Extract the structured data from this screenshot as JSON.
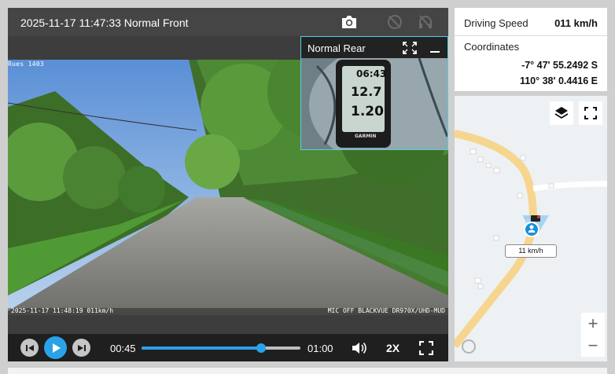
{
  "player": {
    "title": "2025-11-17 11:47:33 Normal Front",
    "osd_top": "Rues 1403",
    "osd_bottom_left": "2025-11-17 11:48:19 011km/h",
    "osd_bottom_right": "MIC OFF BLACKVUE DR970X/UHD-MUD",
    "pip_title": "Normal Rear",
    "pip_readout": {
      "time": "06:43",
      "speed": "12.7",
      "distance": "1.20",
      "brand": "GARMIN"
    },
    "current_time": "00:45",
    "duration": "01:00",
    "progress": 0.75,
    "playback_rate": "2X"
  },
  "info": {
    "speed_label": "Driving Speed",
    "speed_value": "011 km/h",
    "coords_label": "Coordinates",
    "latitude": "-7° 47' 55.2492 S",
    "longitude": "110° 38' 0.4416 E"
  },
  "map": {
    "speed_tag": "11 km/h",
    "zoom_in": "+",
    "zoom_out": "−"
  },
  "colors": {
    "accent": "#2aa2e8",
    "pip_border": "#4fd3e1",
    "road": "#f6d58f",
    "marker": "#1a8fd8"
  }
}
